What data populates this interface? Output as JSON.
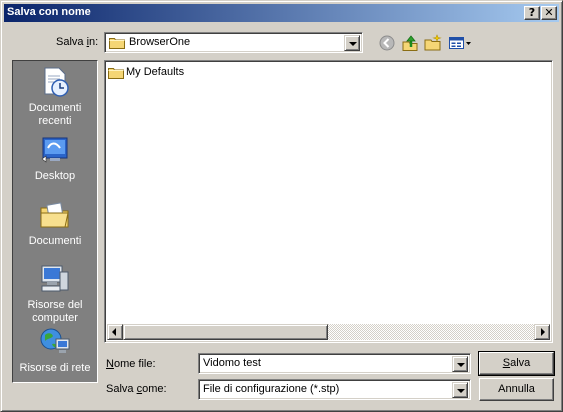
{
  "window": {
    "title": "Salva con nome"
  },
  "titlebar": {
    "help_glyph": "?",
    "close_glyph": "✕"
  },
  "location": {
    "label_pre": "Salva ",
    "label_key": "i",
    "label_post": "n:",
    "value": "BrowserOne"
  },
  "toolbar": {
    "icons": [
      "back-icon",
      "up-folder-icon",
      "new-folder-icon",
      "view-menu-icon"
    ]
  },
  "places": [
    {
      "line1": "Documenti",
      "line2": "recenti",
      "icon": "recent-documents-icon"
    },
    {
      "line1": "Desktop",
      "line2": "",
      "icon": "desktop-icon"
    },
    {
      "line1": "Documenti",
      "line2": "",
      "icon": "documents-icon"
    },
    {
      "line1": "Risorse del",
      "line2": "computer",
      "icon": "my-computer-icon"
    },
    {
      "line1": "Risorse di rete",
      "line2": "",
      "icon": "network-icon"
    }
  ],
  "files": [
    {
      "name": "My Defaults",
      "type": "folder"
    }
  ],
  "filename": {
    "label_key": "N",
    "label_post": "ome file:",
    "value": "Vidomo test"
  },
  "filetype": {
    "label_pre": "Salva ",
    "label_key": "c",
    "label_post": "ome:",
    "value": "File di configurazione (*.stp)"
  },
  "buttons": {
    "save_key": "S",
    "save_post": "alva",
    "cancel": "Annulla"
  },
  "colors": {
    "title_start": "#0a246a",
    "title_end": "#a6caf0",
    "face": "#d4d0c8",
    "places_bg": "#808080"
  }
}
